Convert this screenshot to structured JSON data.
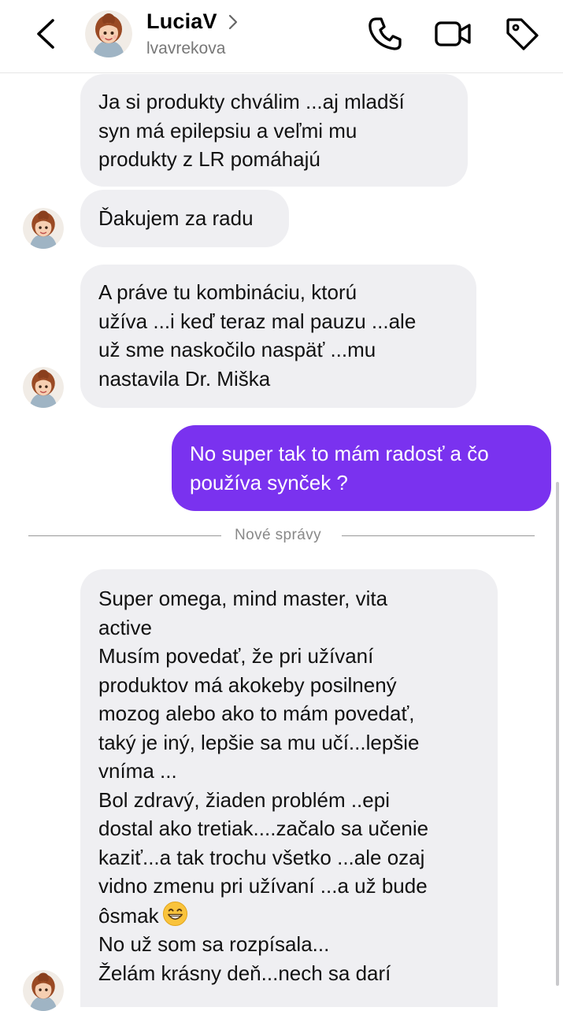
{
  "header": {
    "contact_name": "LuciaV",
    "contact_handle": "lvavrekova",
    "icons": {
      "back": "chevron-left-icon",
      "name_chevron": "chevron-right-icon",
      "call": "phone-icon",
      "video": "video-camera-icon",
      "tag": "tag-icon"
    }
  },
  "messages": [
    {
      "from": "contact",
      "lines": [
        "Ja si produkty chválim ...aj mladší",
        "syn má epilepsiu a veľmi mu",
        "produkty z LR pomáhajú"
      ]
    },
    {
      "from": "contact",
      "lines": [
        "Ďakujem za radu"
      ]
    },
    {
      "from": "contact",
      "lines": [
        "A práve tu kombináciu, ktorú",
        "užíva ...i keď teraz mal pauzu ...ale",
        "už sme naskočilo naspäť ...mu",
        "nastavila Dr. Miška"
      ]
    },
    {
      "from": "me",
      "lines": [
        "No super tak to mám radosť a čo",
        "používa synček ?"
      ]
    },
    {
      "from": "contact",
      "lines": [
        "Super omega, mind master, vita",
        "active",
        "Musím povedať, že pri užívaní",
        "produktov má akokeby posilnený",
        "mozog alebo ako to mám povedať,",
        "taký je iný, lepšie sa mu učí...lepšie",
        "vníma ...",
        "Bol zdravý, žiaden problém ..epi",
        "dostal ako tretiak....začalo sa učenie",
        "kaziť...a tak trochu všetko ...ale ozaj",
        "vidno zmenu pri užívaní ...a už bude",
        "ôsmak",
        "No už som sa rozpísala...",
        "Želám krásny deň...nech sa darí"
      ],
      "emoji_after_line": 11,
      "emoji": "grinning-face-with-smiling-eyes-icon"
    }
  ],
  "divider": {
    "label": "Nové správy"
  },
  "colors": {
    "outgoing_bubble": "#7a32ef",
    "incoming_bubble": "#efeff2",
    "accent": "#7a32ef"
  }
}
